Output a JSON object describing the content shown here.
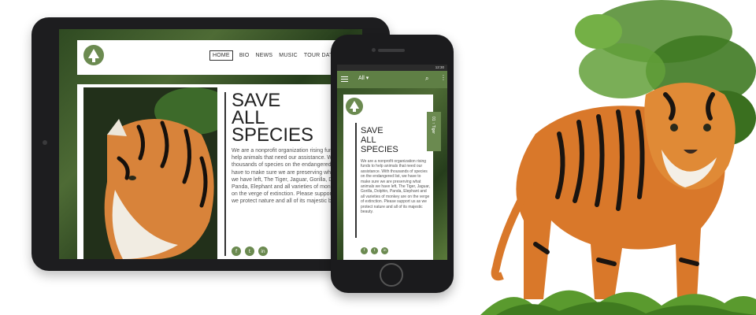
{
  "colors": {
    "brand_green": "#6b8a50",
    "appbar_green": "#5f7f45",
    "device_frame": "#1d1d1f",
    "text_dark": "#222222",
    "text_body": "#555555"
  },
  "tablet": {
    "nav": [
      "HOME",
      "BIO",
      "NEWS",
      "MUSIC",
      "TOUR DATES"
    ],
    "active_nav": "HOME",
    "logo_icon": "tree-icon",
    "title_lines": [
      "SAVE",
      "ALL",
      "SPECIES"
    ],
    "body": "We are a nonprofit organization rising funds to help animals that need our assistance. With thousands of species on the endangered list, we have to make sure we are preserving what animals we have left, The Tiger, Jaguar, Gorilla, Dolphin, Panda, Elephant and all varieties of monkey are on the verge of extinction. Please support us as we protect nature and all of its majestic beauty.",
    "social": [
      {
        "icon": "facebook-icon",
        "glyph": "f"
      },
      {
        "icon": "twitter-icon",
        "glyph": "t"
      },
      {
        "icon": "linkedin-icon",
        "glyph": "in"
      }
    ]
  },
  "phone": {
    "status_time": "12:30",
    "appbar_filter": "All",
    "title_lines": [
      "SAVE",
      "ALL",
      "SPECIES"
    ],
    "body": "We are a nonprofit organization rising funds to help animals that need our assistance. With thousands of species on the endangered list, we have to make sure we are preserving what animals we have left, The Tiger, Jaguar, Gorilla, Dolphin, Panda, Elephant and all varieties of monkey are on the verge of extinction. Please support us as we protect nature and all of its majestic beauty.",
    "side_tab": "01 ↑ Tiger",
    "social": [
      {
        "icon": "facebook-icon",
        "glyph": "f"
      },
      {
        "icon": "twitter-icon",
        "glyph": "t"
      },
      {
        "icon": "linkedin-icon",
        "glyph": "in"
      }
    ]
  }
}
